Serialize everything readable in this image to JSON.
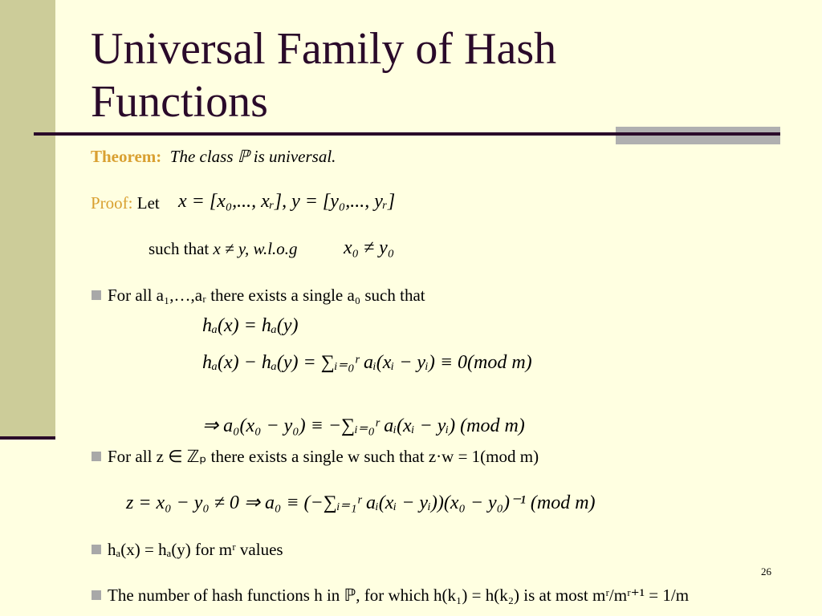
{
  "slide": {
    "title": "Universal Family of Hash Functions",
    "page_number": "26",
    "colors": {
      "background": "#ffffe1",
      "sidebar": "#cccc99",
      "title": "#2a0a2a",
      "label": "#d9a031",
      "bullet": "#a8a8a8"
    }
  },
  "theorem": {
    "label": "Theorem:",
    "text": "The class ℙ is universal."
  },
  "proof": {
    "label": "Proof:",
    "let": "Let",
    "formula": "x = [x₀,..., xᵣ], y = [y₀,..., yᵣ]",
    "cond_text": "such that",
    "cond": "x ≠ y, w.l.o.g",
    "cond_formula": "x₀ ≠ y₀"
  },
  "bullets": [
    {
      "text": "For all a₁,…,aᵣ there exists a single a₀ such that"
    },
    {
      "text": "For all z ∈ ℤₚ there exists a single w such that z·w = 1(mod m)"
    },
    {
      "text": "hₐ(x) = hₐ(y) for mʳ values"
    },
    {
      "text": "The number of hash functions h in ℙ, for which h(k₁) = h(k₂) is at most mʳ/mʳ⁺¹ = 1/m"
    }
  ],
  "equations": {
    "eq1": "hₐ(x) = hₐ(y)",
    "eq2": "hₐ(x) − hₐ(y) = ∑ᵢ₌₀ʳ aᵢ(xᵢ − yᵢ) ≡ 0(mod m)",
    "eq3": "⇒ a₀(x₀ − y₀) ≡ −∑ᵢ₌₀ʳ aᵢ(xᵢ − yᵢ) (mod m)",
    "eq4": "z = x₀ − y₀ ≠ 0 ⇒ a₀ ≡ (−∑ᵢ₌₁ʳ aᵢ(xᵢ − yᵢ))(x₀ − y₀)⁻¹ (mod m)"
  }
}
